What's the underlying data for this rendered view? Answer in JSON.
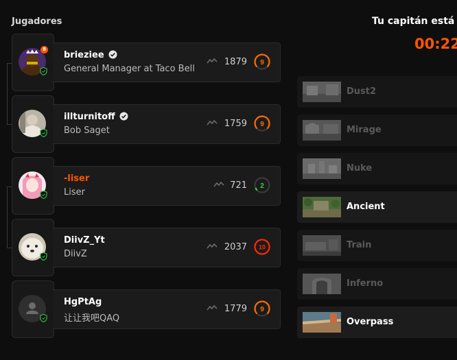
{
  "section_title": "Jugadores",
  "captain_text": "Tu capitán está v",
  "timer": "00:22",
  "colors": {
    "accent": "#ff5500",
    "online": "#2fbf4b",
    "level_green": "#3ccf3c",
    "level_red": "#ff2a00"
  },
  "players": [
    {
      "nickname": "brieziee",
      "verified": true,
      "subtitle": "General Manager at Taco Bell",
      "elo": "1879",
      "level": "9",
      "level_badge": "8",
      "nick_accent": false
    },
    {
      "nickname": "illturnitoff",
      "verified": true,
      "subtitle": "Bob Saget",
      "elo": "1759",
      "level": "9",
      "level_badge": "",
      "nick_accent": false
    },
    {
      "nickname": "-liser",
      "verified": false,
      "subtitle": "Liser",
      "elo": "721",
      "level": "2",
      "level_badge": "",
      "nick_accent": true
    },
    {
      "nickname": "DiivZ_Yt",
      "verified": false,
      "subtitle": "DiivZ",
      "elo": "2037",
      "level": "10",
      "level_badge": "",
      "nick_accent": false
    },
    {
      "nickname": "HgPtAg",
      "verified": false,
      "subtitle": "让让我吧QAQ",
      "elo": "1779",
      "level": "9",
      "level_badge": "",
      "nick_accent": false
    }
  ],
  "maps": [
    {
      "name": "Dust2",
      "status": "banned"
    },
    {
      "name": "Mirage",
      "status": "banned"
    },
    {
      "name": "Nuke",
      "status": "banned"
    },
    {
      "name": "Ancient",
      "status": "available"
    },
    {
      "name": "Train",
      "status": "banned"
    },
    {
      "name": "Inferno",
      "status": "banned"
    },
    {
      "name": "Overpass",
      "status": "available"
    }
  ]
}
